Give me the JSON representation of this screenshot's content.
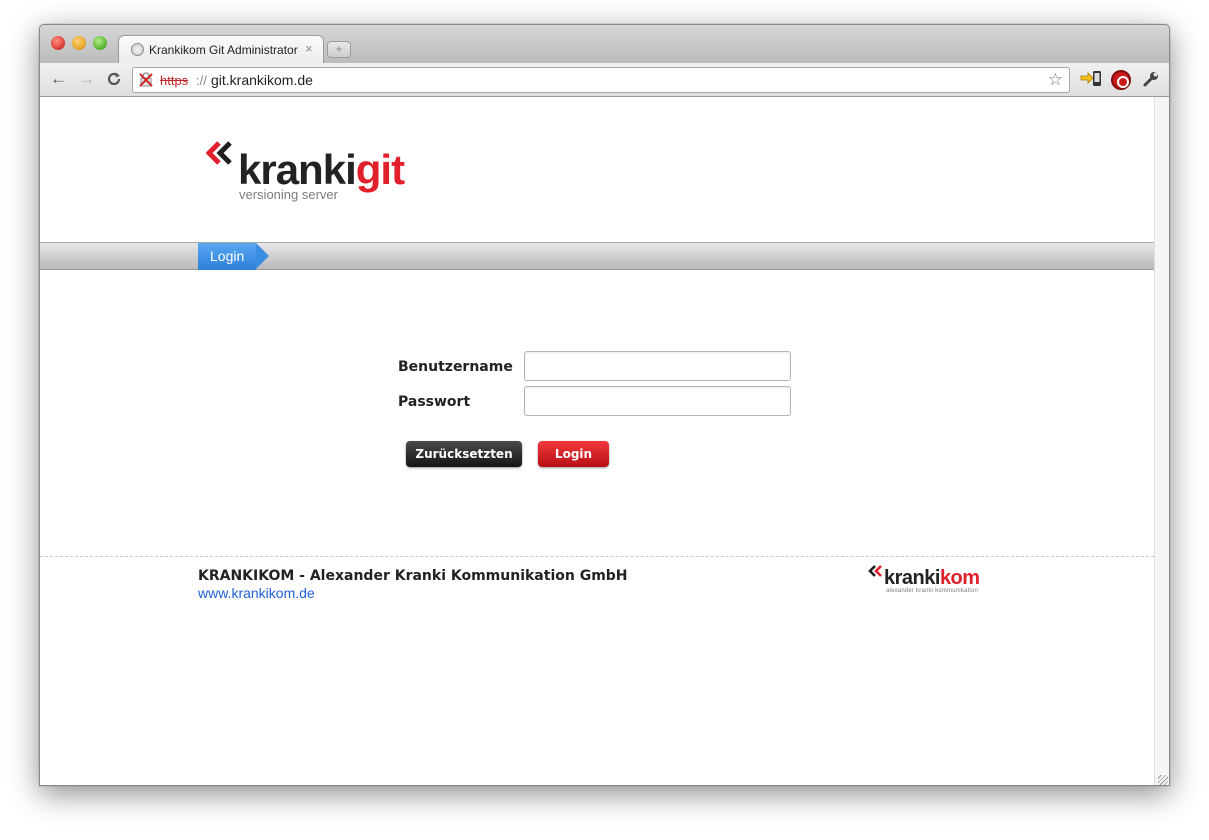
{
  "browser": {
    "tab_title": "Krankikom Git Administrator",
    "tab_close": "×",
    "new_tab": "+",
    "url_scheme": "https",
    "url_separator": "://",
    "url_host": "git.krankikom.de",
    "icons": {
      "back": "←",
      "forward": "→",
      "reload": "C",
      "lock": "✘",
      "star": "☆",
      "extension": "⇨",
      "wrench": "🔧"
    }
  },
  "header": {
    "logo_word_main": "kranki",
    "logo_word_accent": "git",
    "logo_subtitle": "versioning server"
  },
  "navbar": {
    "active_item": "Login"
  },
  "login_form": {
    "username_label": "Benutzername",
    "username_value": "",
    "password_label": "Passwort",
    "password_value": "",
    "reset_button": "Zurücksetzten",
    "login_button": "Login"
  },
  "footer": {
    "company": "KRANKIKOM - Alexander Kranki Kommunikation GmbH",
    "link": "www.krankikom.de",
    "logo_word_main": "kranki",
    "logo_word_accent": "kom",
    "logo_subtitle": "alexander kranki kommunikation"
  },
  "colors": {
    "brand_red": "#e0202a",
    "nav_blue": "#2d7fd9",
    "link_blue": "#1f5fd6"
  }
}
